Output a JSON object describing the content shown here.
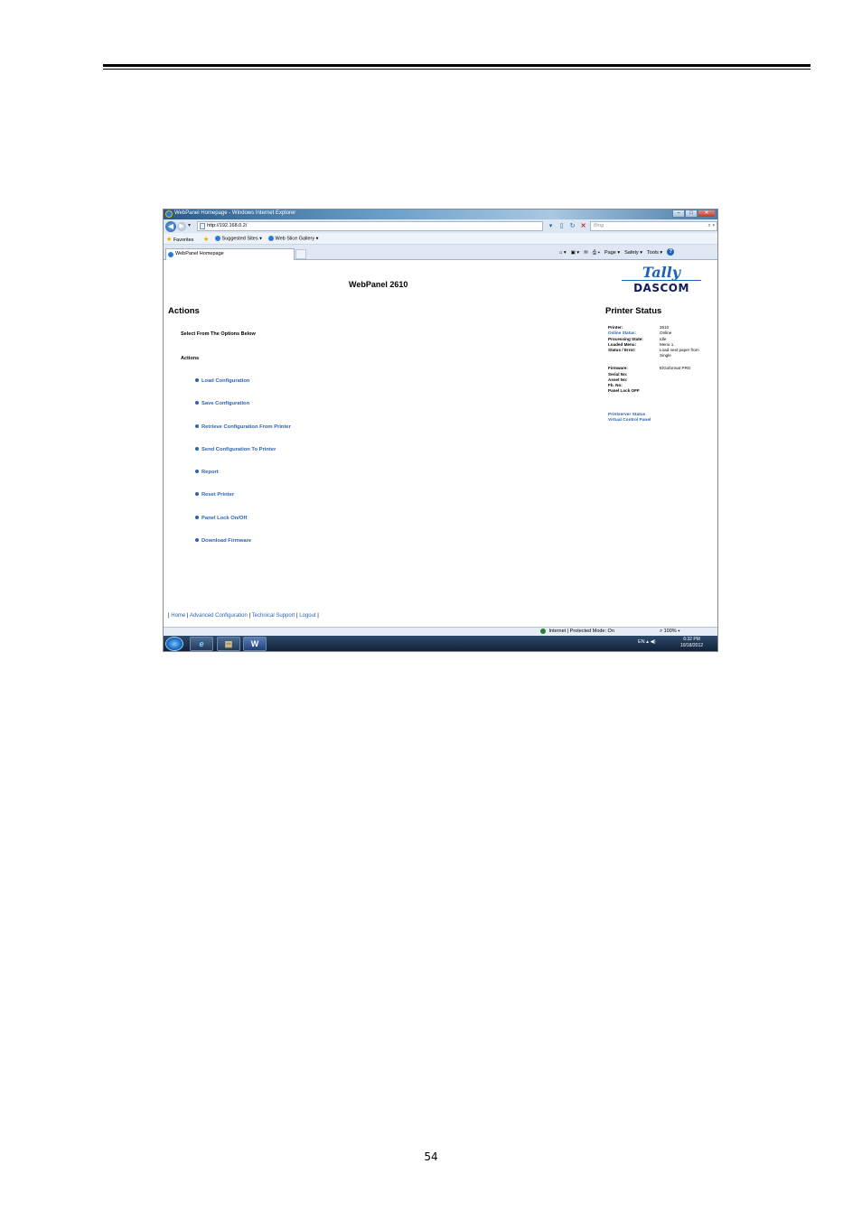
{
  "page_number": "54",
  "browser": {
    "window_title": "WebPanel Homepage - Windows Internet Explorer",
    "url": "http://192.168.0.2/",
    "search_placeholder": "Bing",
    "favorites": {
      "label": "Favorites",
      "suggested_sites": "Suggested Sites ▾",
      "web_slice_gallery": "Web Slice Gallery ▾"
    },
    "tab_label": "WebPanel Homepage",
    "command_bar": {
      "page": "Page ▾",
      "safety": "Safety ▾",
      "tools": "Tools ▾",
      "help": "?"
    },
    "status_zone": "Internet | Protected Mode: On",
    "zoom": "100%"
  },
  "webpanel": {
    "title": "WebPanel 2610",
    "logo_top": "Tally",
    "logo_bottom": "DASCOM",
    "actions_heading": "Actions",
    "select_text": "Select From The Options Below",
    "actions_label": "Actions",
    "actions": [
      "Load Configuration",
      "Save Configuration",
      "Retrieve Configuration From Printer",
      "Send Configuration To Printer",
      "Report",
      "Reset Printer",
      "Panel Lock On/Off",
      "Download Firmware"
    ],
    "printer_status_heading": "Printer Status",
    "status_rows": [
      {
        "label": "Printer:",
        "value": "2610"
      },
      {
        "label": "Online Status:",
        "value": "Online"
      },
      {
        "label": "Processing State:",
        "value": "Idle"
      },
      {
        "label": "Loaded Menu:",
        "value": "Menu 1"
      },
      {
        "label": "Status / Error:",
        "value": "Load next paper from"
      },
      {
        "label": "",
        "value": "Single"
      },
      {
        "label": "Firmware:",
        "value": "ElGoformat PRG"
      },
      {
        "label": "Serial No:",
        "value": ""
      },
      {
        "label": "Asset No:",
        "value": ""
      },
      {
        "label": "Fb. No:",
        "value": ""
      },
      {
        "label": "Panel Lock OFF",
        "value": ""
      }
    ],
    "status_links": [
      "Printserver Status",
      "Virtual Control Panel"
    ],
    "footer_links": [
      "Home",
      "Advanced Configuration",
      "Technical Support",
      "Logout"
    ]
  },
  "taskbar": {
    "language": "EN",
    "time": "6:32 PM",
    "date": "10/18/2012",
    "word_icon": "W"
  }
}
